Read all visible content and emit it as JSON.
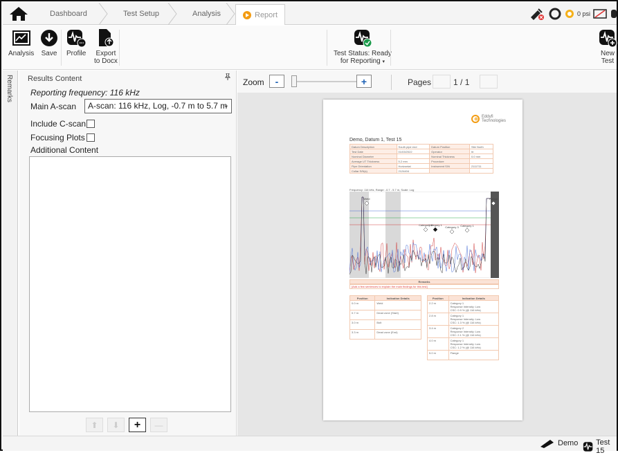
{
  "nav": {
    "crumbs": [
      "Dashboard",
      "Test Setup",
      "Analysis"
    ],
    "active_tab": "Report",
    "pressure": "0 psi"
  },
  "ribbon": {
    "analysis": "Analysis",
    "save": "Save",
    "profile": "Profile",
    "export_line1": "Export",
    "export_line2": "to Docx",
    "test_status_line1": "Test Status: Ready",
    "test_status_line2": "for Reporting",
    "new_test_line1": "New",
    "new_test_line2": "Test"
  },
  "sidebar_tab": "Remarks",
  "results": {
    "header": "Results Content",
    "reporting_frequency": "Reporting frequency: 116 kHz",
    "main_ascan_label": "Main A-scan",
    "main_ascan_value": "A-scan: 116 kHz, Log, -0.7 m to 5.7 m",
    "include_cscan_label": "Include C-scan",
    "include_cscan_checked": false,
    "focusing_plots_label": "Focusing Plots",
    "focusing_plots_checked": false,
    "additional_content_label": "Additional Content"
  },
  "zoom": {
    "label": "Zoom",
    "minus": "-",
    "plus": "+",
    "level": 0
  },
  "pages": {
    "label": "Pages",
    "current": "1",
    "separator": "/",
    "total": "1"
  },
  "document": {
    "logo_line1": "Eddyfi",
    "logo_line2": "Technologies",
    "title": "Demo, Datum 1, Test 15",
    "info_rows": [
      [
        "Datum Description",
        "South pipe end",
        "Datum Position",
        "Site North"
      ],
      [
        "Test Date",
        "01/03/2022",
        "Operator",
        "ht"
      ],
      [
        "Nominal Diameter",
        "",
        "Nominal Thickness",
        "0.0 mm"
      ],
      [
        "Average UT Thickness",
        "5.2 mm",
        "Procedure",
        ""
      ],
      [
        "Pipe Orientation",
        "Horizontal",
        "Instrument S/N",
        "2111711"
      ],
      [
        "Collar S/N(s)",
        "2124404",
        "",
        ""
      ]
    ],
    "scan_caption": "Frequency: 116 kHz, Range: -0.7 - 5.7 m, Scale: Log",
    "scan_markers": [
      "Weld",
      "Flange",
      "Category 2",
      "Category 1",
      "Category 3",
      "Category 1"
    ],
    "remarks_title": "Remarks",
    "remarks_text": "[Add a few sentences to explain the main findings for this test]",
    "indication_headers": [
      "Position",
      "Indication Details"
    ],
    "indications_left": [
      {
        "pos": "0.0 m",
        "detail": "Weld"
      },
      {
        "pos": "0.7 m",
        "detail": "Dead zone (Start)"
      },
      {
        "pos": "3.0 m",
        "detail": "Bolt"
      },
      {
        "pos": "3.3 m",
        "detail": "Dead zone (End)"
      }
    ],
    "indications_right": [
      {
        "pos": "2.2 m",
        "detail": "Category 1",
        "sub1": "Response Intensity: Low",
        "sub2": "CSC: 0.9 % (@ 116 kHz)"
      },
      {
        "pos": "2.8 m",
        "detail": "Category 1",
        "sub1": "Response Intensity: Low",
        "sub2": "CSC: 1.3 % (@ 116 kHz)"
      },
      {
        "pos": "3.4 m",
        "detail": "Category 2",
        "sub1": "Response Intensity: Low",
        "sub2": "CSC: 2.1 % (@ 116 kHz)"
      },
      {
        "pos": "4.0 m",
        "detail": "Category 1",
        "sub1": "Response Intensity: Low",
        "sub2": "CSC: 1.2 % (@ 116 kHz)"
      },
      {
        "pos": "5.0 m",
        "detail": "Flange",
        "sub1": "",
        "sub2": ""
      }
    ]
  },
  "statusbar": {
    "site": "Demo",
    "test": "Test 15"
  },
  "colors": {
    "accent_blue": "#1a5fb4",
    "report_orange": "#f39c12",
    "ready_green": "#1a9a4a",
    "doc_table_border": "#f2c9b0",
    "remarks_red": "#e0403a"
  }
}
